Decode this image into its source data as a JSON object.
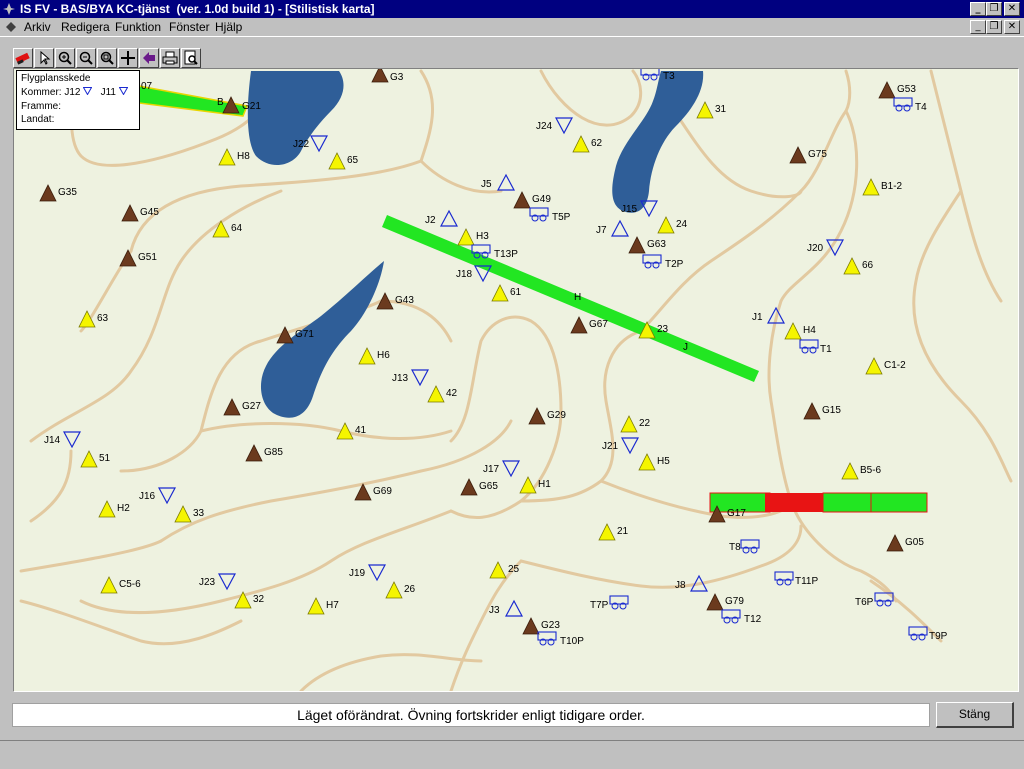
{
  "window": {
    "title": "IS FV - BAS/BYA KC-tjänst  (ver. 1.0d build 1) - [Stilistisk karta]",
    "buttons": [
      "_",
      "❐",
      "✕"
    ]
  },
  "menu": {
    "items": [
      "Arkiv",
      "Redigera",
      "Funktion",
      "Fönster",
      "Hjälp"
    ]
  },
  "toolbar": {
    "tools": [
      "pen-icon",
      "pointer-icon",
      "zoom-in-icon",
      "zoom-out-icon",
      "zoom-fit-icon",
      "crosshair-icon",
      "back-arrow-icon",
      "print-icon",
      "preview-icon"
    ]
  },
  "legend": {
    "title": "Flygplansskede",
    "kommer_label": "Kommer:",
    "kommer_items": [
      "J12",
      "J11"
    ],
    "framme": "Framme:",
    "landat": "Landat:"
  },
  "status": {
    "message": "Läget oförändrat. Övning fortskrider enligt tidigare order.",
    "close_label": "Stäng"
  },
  "map": {
    "colors": {
      "background": "#eef2e0",
      "water": "#2f5e98",
      "road": "#e0c8a0",
      "runway_ok": "#22e622",
      "runway_damaged": "#e81414",
      "yellow_marker": "#f5f500",
      "brown_marker": "#6b3a1e",
      "blue_marker": "#1a2ad0"
    },
    "labels_visible": [
      "G3",
      "T3",
      "07",
      "B",
      "G21",
      "J22",
      "65",
      "H8",
      "G35",
      "G45",
      "64",
      "G51",
      "63",
      "G71",
      "G27",
      "G85",
      "51",
      "J14",
      "H2",
      "J16",
      "33",
      "C5-6",
      "J23",
      "32",
      "H7",
      "J19",
      "26",
      "25",
      "J3",
      "G23",
      "T10P",
      "T7P",
      "J8",
      "G79",
      "T12",
      "T11P",
      "T6P",
      "T9P",
      "G05",
      "T8",
      "G17",
      "B5-6",
      "G15",
      "C1-2",
      "H4",
      "T1",
      "J1",
      "66",
      "J20",
      "B1-2",
      "G75",
      "G53",
      "T4",
      "31",
      "J24",
      "62",
      "J5",
      "G49",
      "T5P",
      "J2",
      "H3",
      "T13P",
      "J18",
      "61",
      "G43",
      "H6",
      "J13",
      "42",
      "41",
      "G29",
      "G69",
      "G65",
      "H1",
      "J17",
      "J7",
      "J15",
      "24",
      "G63",
      "T2P",
      "G67",
      "23",
      "H",
      "J",
      "22",
      "J21",
      "H5",
      "21"
    ]
  }
}
